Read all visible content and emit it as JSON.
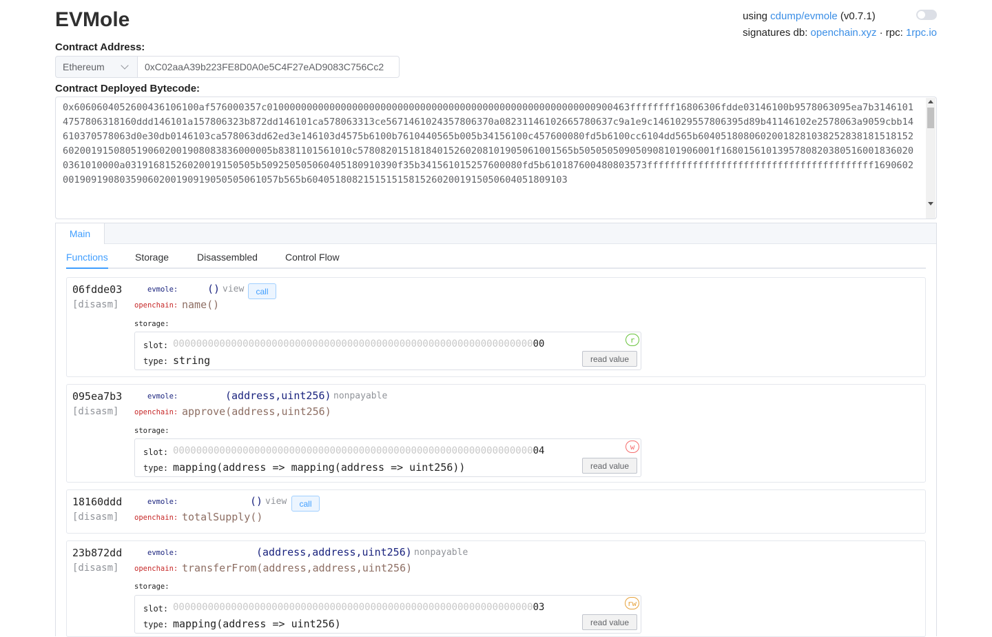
{
  "app": {
    "title": "EVMole"
  },
  "header": {
    "using_prefix": "using ",
    "repo_link": "cdump/evmole",
    "version": " (v0.7.1)",
    "sigdb_prefix": "signatures db: ",
    "sigdb_link": "openchain.xyz",
    "rpc_prefix": " · rpc: ",
    "rpc_link": "1rpc.io"
  },
  "address": {
    "label": "Contract Address:",
    "network": "Ethereum",
    "value": "0xC02aaA39b223FE8D0A0e5C4F27eAD9083C756Cc2"
  },
  "bytecode": {
    "label": "Contract Deployed Bytecode:",
    "value": "0x6060604052600436106100af576000357c0100000000000000000000000000000000000000000000000000000000900463ffffffff16806306fdde03146100b9578063095ea7b31461014757806318160ddd146101a157806323b872dd146101ca578063313ce5671461024357806370a08231146102665780637c9a1e9c1461029557806395d89b41146102e2578063a9059cbb14610370578063d0e30db0146103ca578063dd62ed3e146103d4575b6100b7610440565b005b34156100c457600080fd5b6100cc6104dd565b604051808060200182810382528381815181526020019150805190602001908083836000005b8381101561010c57808201518184015260208101905061001565b505050509050908101906001f16801561013957808203805160018360200361010000a03191681526020019150505b50925050506040518091039",
    "value_rest": "0f35b341561015257600080fd5b610187600480803573ffffffffffffffffffffffffffffffffffffffff169060200190919080359060200190919050505061057b565b6040518082151515158152602001915050604051809103"
  },
  "tabs": {
    "outer": [
      "Main"
    ],
    "inner": [
      "Functions",
      "Storage",
      "Disassembled",
      "Control Flow"
    ],
    "active_inner": "Functions"
  },
  "labels": {
    "disasm": "[disasm]",
    "evmole": "evmole:",
    "openchain": "openchain:",
    "storage": "storage:",
    "slot": "slot:",
    "type": "type:",
    "read_value": "read value",
    "call": "call"
  },
  "functions": [
    {
      "selector": "06fdde03",
      "args": "()",
      "mutability": "view",
      "signature": "name()",
      "storage": {
        "slot_prefix": "00000000000000000000000000000000000000000000000000000000000000",
        "slot_tail": "00",
        "type": "string",
        "access": "r"
      }
    },
    {
      "selector": "095ea7b3",
      "args": "(address,uint256)",
      "mutability": "nonpayable",
      "signature": "approve(address,uint256)",
      "storage": {
        "slot_prefix": "00000000000000000000000000000000000000000000000000000000000000",
        "slot_tail": "04",
        "type": "mapping(address => mapping(address => uint256))",
        "access": "w"
      }
    },
    {
      "selector": "18160ddd",
      "args": "()",
      "mutability": "view",
      "signature": "totalSupply()"
    },
    {
      "selector": "23b872dd",
      "args": "(address,address,uint256)",
      "mutability": "nonpayable",
      "signature": "transferFrom(address,address,uint256)",
      "storage": {
        "slot_prefix": "00000000000000000000000000000000000000000000000000000000000000",
        "slot_tail": "03",
        "type": "mapping(address => uint256)",
        "access": "rw"
      }
    }
  ],
  "colors": {
    "accent": "#409eff",
    "evmole": "#1a237e",
    "openchain": "#c62828",
    "signature": "#8d6e63"
  }
}
